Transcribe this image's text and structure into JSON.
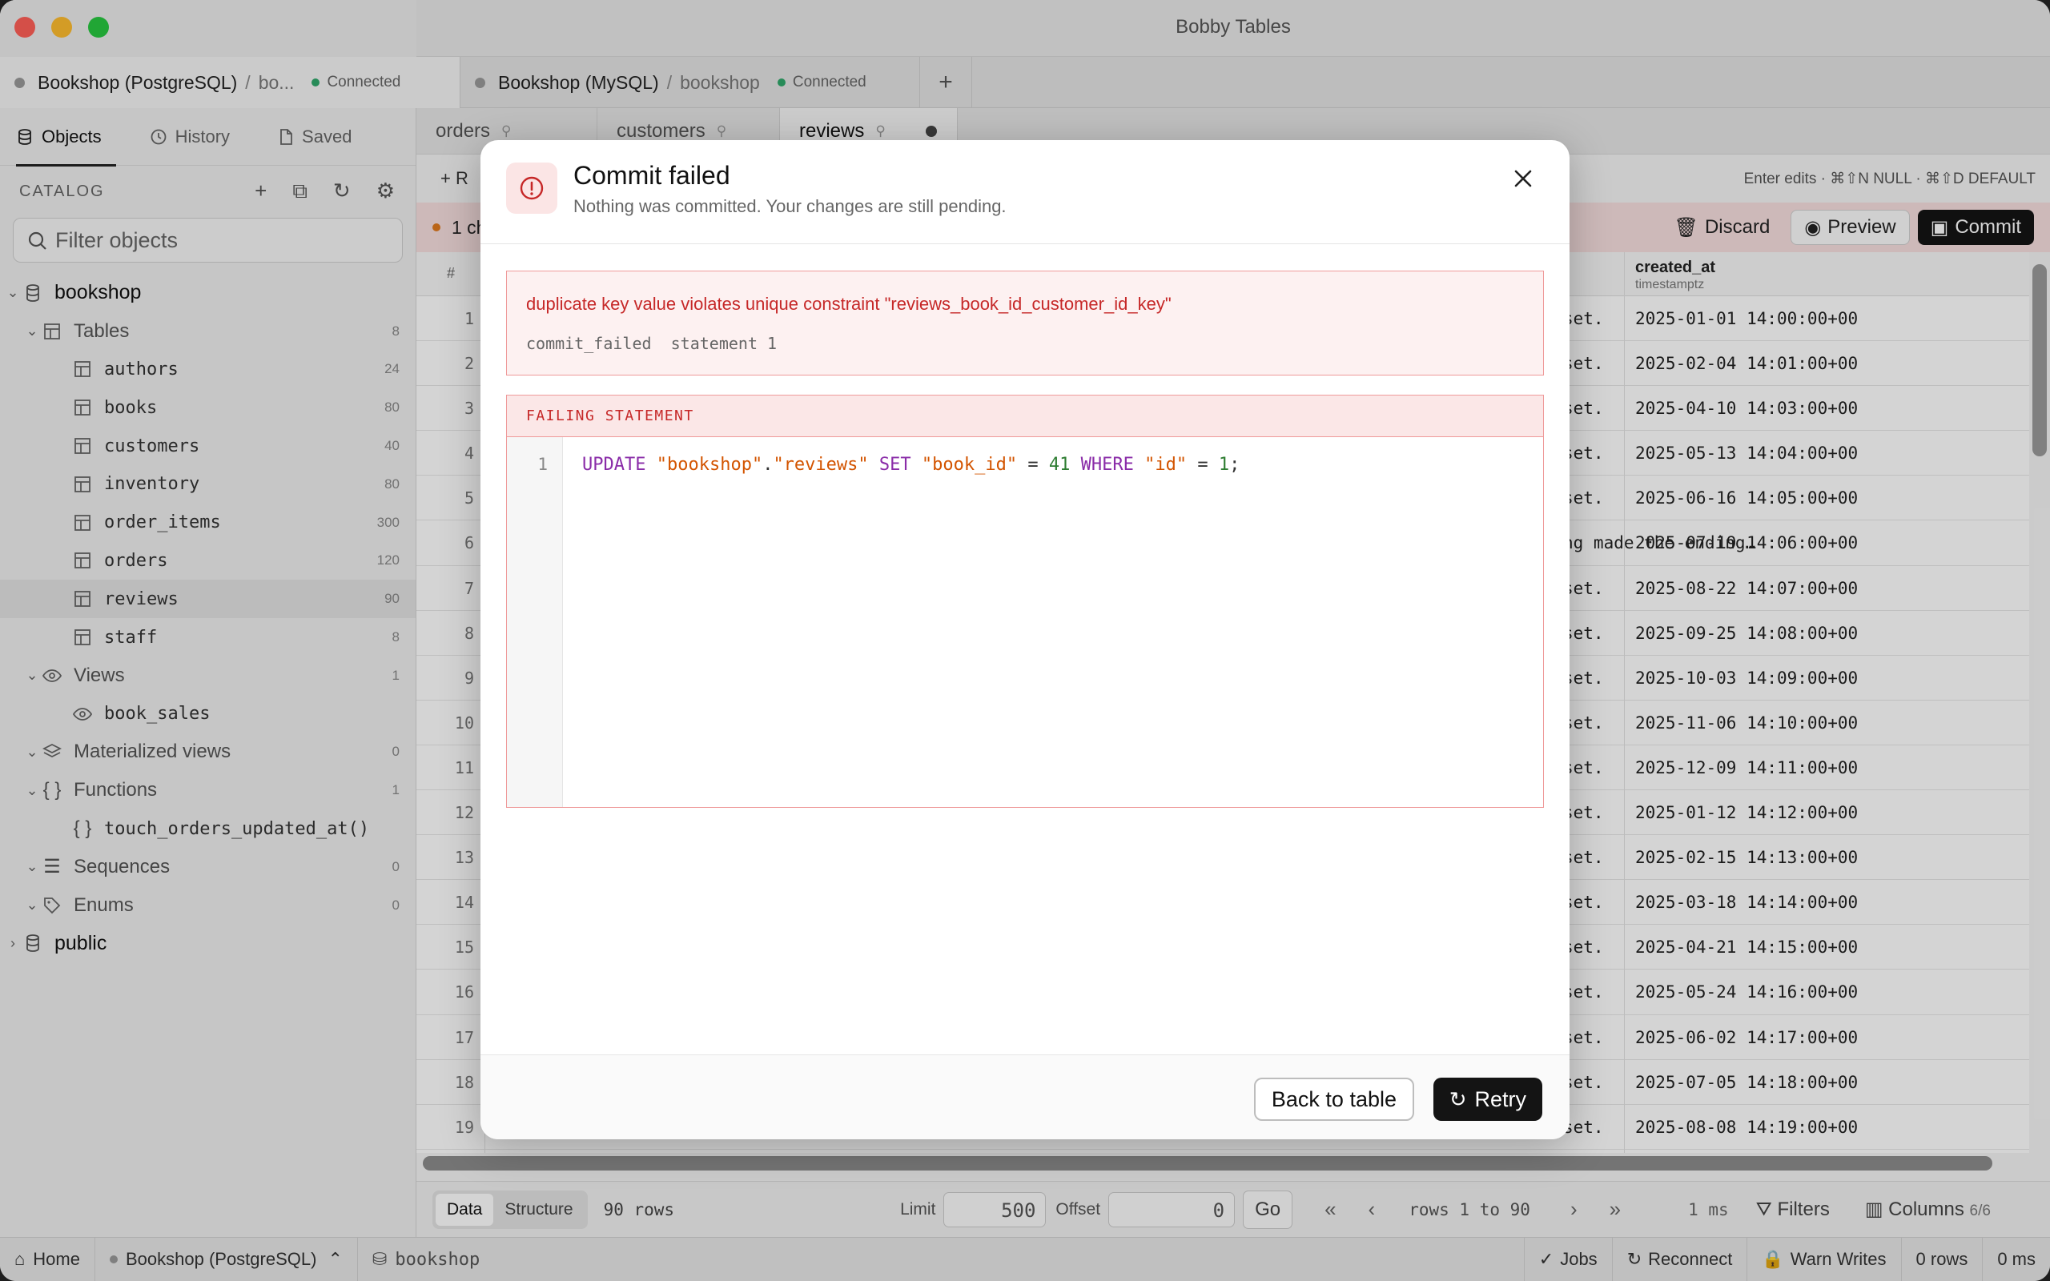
{
  "window": {
    "title": "Bobby Tables"
  },
  "connections": [
    {
      "name": "Bookshop (PostgreSQL)",
      "db": "bo...",
      "status": "Connected"
    },
    {
      "name": "Bookshop (MySQL)",
      "db": "bookshop",
      "status": "Connected"
    }
  ],
  "sidebar": {
    "tabs": [
      "Objects",
      "History",
      "Saved"
    ],
    "catalog_label": "CATALOG",
    "filter_placeholder": "Filter objects",
    "tree": {
      "root": "bookshop",
      "tables_label": "Tables",
      "tables_count": "8",
      "tables": [
        {
          "name": "authors",
          "count": "24"
        },
        {
          "name": "books",
          "count": "80"
        },
        {
          "name": "customers",
          "count": "40"
        },
        {
          "name": "inventory",
          "count": "80"
        },
        {
          "name": "order_items",
          "count": "300"
        },
        {
          "name": "orders",
          "count": "120"
        },
        {
          "name": "reviews",
          "count": "90"
        },
        {
          "name": "staff",
          "count": "8"
        }
      ],
      "views_label": "Views",
      "views_count": "1",
      "view": "book_sales",
      "matviews_label": "Materialized views",
      "matviews_count": "0",
      "functions_label": "Functions",
      "functions_count": "1",
      "function": "touch_orders_updated_at()",
      "sequences_label": "Sequences",
      "sequences_count": "0",
      "enums_label": "Enums",
      "enums_count": "0",
      "public": "public"
    }
  },
  "query_tabs": [
    "orders",
    "customers",
    "reviews"
  ],
  "toolbar": {
    "add_label": "R",
    "hint": "Enter edits · ⌘⇧N NULL · ⌘⇧D DEFAULT"
  },
  "pending": {
    "text": "1 ch",
    "discard": "Discard",
    "preview": "Preview",
    "commit": "Commit"
  },
  "grid": {
    "hash": "#",
    "col_created": "created_at",
    "col_created_type": "timestamptz",
    "rows": [
      {
        "n": "1",
        "body": "set.",
        "created_at": "2025-01-01 14:00:00+00"
      },
      {
        "n": "2",
        "body": "set.",
        "created_at": "2025-02-04 14:01:00+00"
      },
      {
        "n": "3",
        "body": "set.",
        "created_at": "2025-04-10 14:03:00+00"
      },
      {
        "n": "4",
        "body": "set.",
        "created_at": "2025-05-13 14:04:00+00"
      },
      {
        "n": "5",
        "body": "set.",
        "created_at": "2025-06-16 14:05:00+00"
      },
      {
        "n": "6",
        "body": "ng made the ending…",
        "created_at": "2025-07-19 14:06:00+00"
      },
      {
        "n": "7",
        "body": "set.",
        "created_at": "2025-08-22 14:07:00+00"
      },
      {
        "n": "8",
        "body": "set.",
        "created_at": "2025-09-25 14:08:00+00"
      },
      {
        "n": "9",
        "body": "set.",
        "created_at": "2025-10-03 14:09:00+00"
      },
      {
        "n": "10",
        "body": "set.",
        "created_at": "2025-11-06 14:10:00+00"
      },
      {
        "n": "11",
        "body": "set.",
        "created_at": "2025-12-09 14:11:00+00"
      },
      {
        "n": "12",
        "body": "set.",
        "created_at": "2025-01-12 14:12:00+00"
      },
      {
        "n": "13",
        "body": "set.",
        "created_at": "2025-02-15 14:13:00+00"
      },
      {
        "n": "14",
        "body": "set.",
        "created_at": "2025-03-18 14:14:00+00"
      },
      {
        "n": "15",
        "body": "set.",
        "created_at": "2025-04-21 14:15:00+00"
      },
      {
        "n": "16",
        "body": "set.",
        "created_at": "2025-05-24 14:16:00+00"
      },
      {
        "n": "17",
        "body": "set.",
        "created_at": "2025-06-02 14:17:00+00"
      },
      {
        "n": "18",
        "body": "set.",
        "created_at": "2025-07-05 14:18:00+00"
      },
      {
        "n": "19",
        "body": "set.",
        "created_at": "2025-08-08 14:19:00+00"
      }
    ]
  },
  "footer": {
    "data": "Data",
    "structure": "Structure",
    "rows": "90 rows",
    "limit_label": "Limit",
    "limit": "500",
    "offset_label": "Offset",
    "offset": "0",
    "go": "Go",
    "range": "rows 1 to 90",
    "time": "1 ms",
    "filters": "Filters",
    "columns": "Columns",
    "columns_count": "6/6"
  },
  "statusbar": {
    "home": "Home",
    "connection": "Bookshop (PostgreSQL)",
    "database": "bookshop",
    "jobs": "Jobs",
    "reconnect": "Reconnect",
    "warn": "Warn Writes",
    "rows": "0 rows",
    "time": "0 ms"
  },
  "modal": {
    "title": "Commit failed",
    "subtitle": "Nothing was committed. Your changes are still pending.",
    "error_message": "duplicate key value violates unique constraint \"reviews_book_id_customer_id_key\"",
    "error_code": "commit_failed",
    "error_statement": "statement 1",
    "failing_label": "FAILING STATEMENT",
    "line_number": "1",
    "sql": {
      "kw_update": "UPDATE",
      "schema": "\"bookshop\"",
      "dot": ".",
      "table": "\"reviews\"",
      "kw_set": "SET",
      "col": "\"book_id\"",
      "eq": "=",
      "val": "41",
      "kw_where": "WHERE",
      "idcol": "\"id\"",
      "idval": "1",
      "semi": ";"
    },
    "back_label": "Back to table",
    "retry_label": "Retry"
  },
  "colors": {
    "accent_error": "#c62828",
    "connected": "#2fa86a",
    "primary_button": "#141414"
  }
}
